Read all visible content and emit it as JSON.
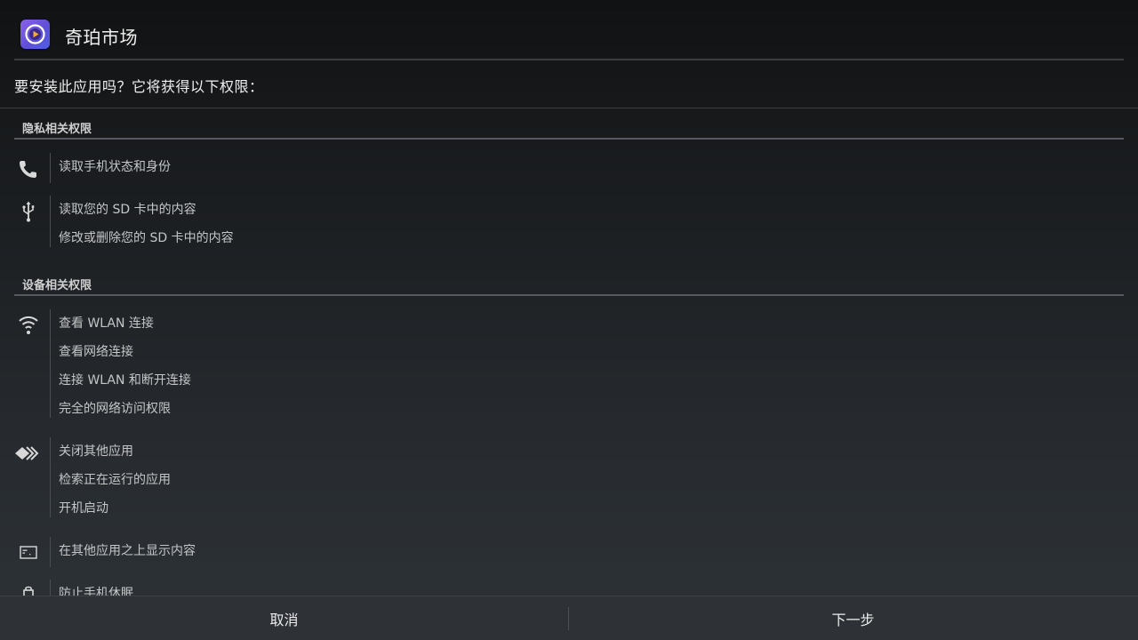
{
  "header": {
    "app_name": "奇珀市场",
    "icon": "app-play-icon"
  },
  "prompt": "要安装此应用吗？它将获得以下权限：",
  "sections": [
    {
      "title": "隐私相关权限",
      "groups": [
        {
          "icon": "phone-icon",
          "items": [
            "读取手机状态和身份"
          ]
        },
        {
          "icon": "usb-icon",
          "items": [
            "读取您的 SD 卡中的内容",
            "修改或删除您的 SD 卡中的内容"
          ]
        }
      ]
    },
    {
      "title": "设备相关权限",
      "groups": [
        {
          "icon": "wifi-icon",
          "items": [
            "查看 WLAN 连接",
            "查看网络连接",
            "连接 WLAN 和断开连接",
            "完全的网络访问权限"
          ]
        },
        {
          "icon": "apps-icon",
          "items": [
            "关闭其他应用",
            "检索正在运行的应用",
            "开机启动"
          ]
        },
        {
          "icon": "overlay-icon",
          "items": [
            "在其他应用之上显示内容"
          ]
        },
        {
          "icon": "lock-icon",
          "items": [
            "防止手机休眠"
          ]
        }
      ]
    }
  ],
  "footer": {
    "cancel_label": "取消",
    "next_label": "下一步"
  }
}
